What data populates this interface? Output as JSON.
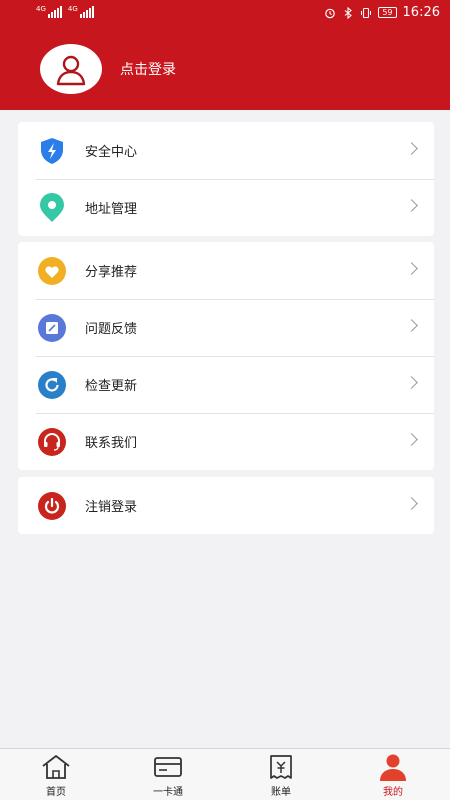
{
  "status_bar": {
    "net1": "4G",
    "net2": "4G",
    "battery": "59",
    "time": "16:26"
  },
  "profile": {
    "login_text": "点击登录"
  },
  "group1": [
    {
      "label": "安全中心",
      "icon": "shield-lightning-icon",
      "color": "#2b7de9"
    },
    {
      "label": "地址管理",
      "icon": "location-pin-icon",
      "color": "#34c8a6"
    }
  ],
  "group2": [
    {
      "label": "分享推荐",
      "icon": "heart-icon",
      "color": "#f0b021"
    },
    {
      "label": "问题反馈",
      "icon": "feedback-edit-icon",
      "color": "#5a78d8"
    },
    {
      "label": "检查更新",
      "icon": "refresh-icon",
      "color": "#2a80c8"
    },
    {
      "label": "联系我们",
      "icon": "headset-icon",
      "color": "#c8251d"
    }
  ],
  "group3": [
    {
      "label": "注销登录",
      "icon": "power-icon",
      "color": "#c8251d"
    }
  ],
  "tabbar": [
    {
      "label": "首页",
      "icon": "home-icon"
    },
    {
      "label": "一卡通",
      "icon": "card-icon"
    },
    {
      "label": "账单",
      "icon": "bill-icon"
    },
    {
      "label": "我的",
      "icon": "user-icon",
      "active": true
    }
  ],
  "colors": {
    "brand_red": "#c8161e",
    "page_bg": "#f2f2f4"
  }
}
